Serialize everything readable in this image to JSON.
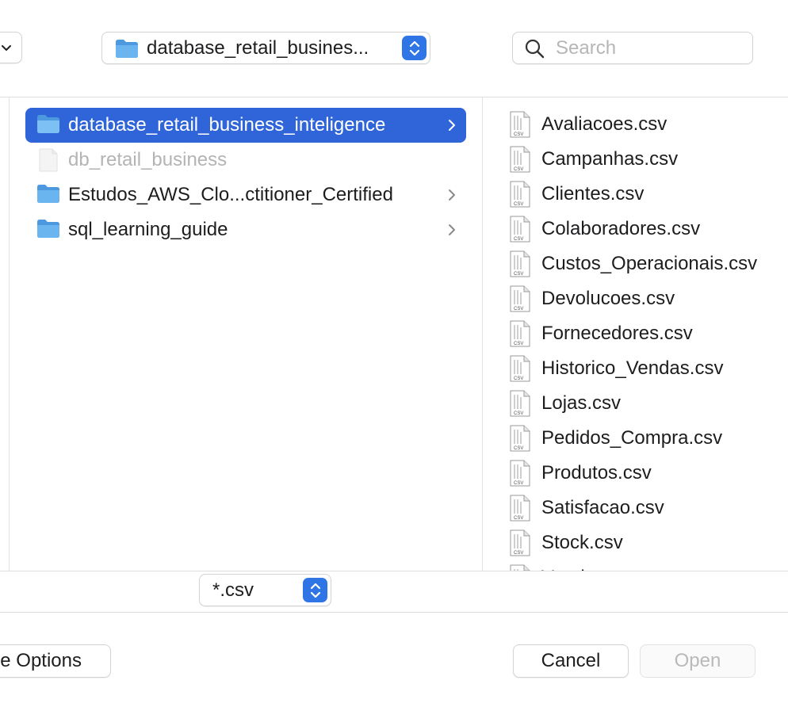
{
  "toolbar": {
    "path_label": "database_retail_busines...",
    "search_placeholder": "Search"
  },
  "folders": [
    {
      "label": "database_retail_business_inteligence",
      "selected": true,
      "has_chevron": true,
      "type": "folder"
    },
    {
      "label": "db_retail_business",
      "selected": false,
      "has_chevron": false,
      "type": "document",
      "dimmed": true
    },
    {
      "label": "Estudos_AWS_Clo...ctitioner_Certified",
      "selected": false,
      "has_chevron": true,
      "type": "folder"
    },
    {
      "label": "sql_learning_guide",
      "selected": false,
      "has_chevron": true,
      "type": "folder"
    }
  ],
  "files": [
    "Avaliacoes.csv",
    "Campanhas.csv",
    "Clientes.csv",
    "Colaboradores.csv",
    "Custos_Operacionais.csv",
    "Devolucoes.csv",
    "Fornecedores.csv",
    "Historico_Vendas.csv",
    "Lojas.csv",
    "Pedidos_Compra.csv",
    "Produtos.csv",
    "Satisfacao.csv",
    "Stock.csv",
    "Vendas.csv"
  ],
  "file_icon_text": "CSV",
  "filter": {
    "label": "*.csv"
  },
  "buttons": {
    "options": "e Options",
    "cancel": "Cancel",
    "open": "Open"
  },
  "colors": {
    "accent": "#2f65d8",
    "stepper": "#2f75e6",
    "folder": "#5aa9ea"
  }
}
